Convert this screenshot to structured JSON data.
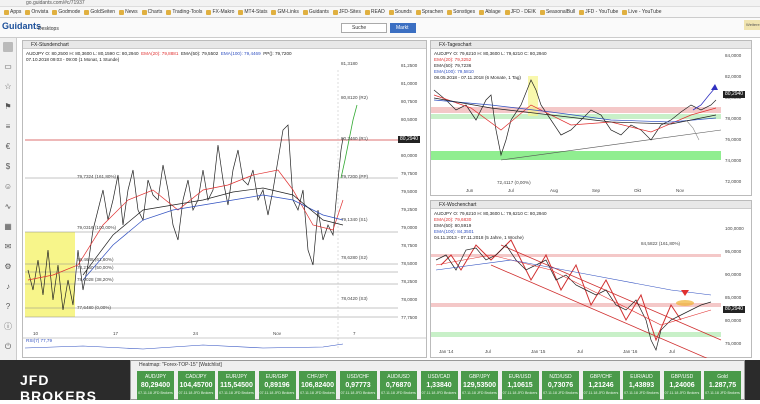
{
  "browser": {
    "url": "go.guidants.com/#c/71937",
    "bookmarks": [
      "Apps",
      "Onvista",
      "Godmode",
      "GoldSeiten",
      "News",
      "Charts",
      "Trading-Tools",
      "FX-Makro",
      "MT4-Stats",
      "GM-Links",
      "Guidants",
      "JFD-Sites",
      "READ",
      "Sounds",
      "Sprachen",
      "Sonstiges",
      "Ablage",
      "JFD - DEIK",
      "SeasonalBull",
      "JFD - YouTube",
      "Live - YouTube",
      "Weitere Lesez."
    ]
  },
  "app": {
    "logo": "Guidants",
    "search_label": "Suche",
    "markt_label": "Markt",
    "desktop_label": "Desktops"
  },
  "panel_left": {
    "title": "FX-Stundenchart",
    "info_line1": "AUDJPY  O: 80,2500  H: 80,3600  L: 80,1590  C: 80,2940",
    "ema20": "EMA(20): 79,8881",
    "ema50": "EMA(50): 79,5502",
    "ema100": "EMA(100): 79,4469",
    "pp": "PP(): 79,7200",
    "info_line2": "07.10.2018 09:03 - 09:00  (1 Monat, 1 Stunde)",
    "levels": [
      {
        "label": "81,3180",
        "name": ""
      },
      {
        "label": "80,8120 (R2)",
        "name": ""
      },
      {
        "label": "80,2460 (R1)",
        "name": ""
      },
      {
        "label": "79,7200 (PP)",
        "name": ""
      },
      {
        "label": "79,1340 (S1)",
        "name": ""
      },
      {
        "label": "78,6280 (S2)",
        "name": ""
      },
      {
        "label": "78,0420 (S3)",
        "name": ""
      }
    ],
    "fib_labels": [
      "79,7324 (161,80%)",
      "79,0316 (100,00%)",
      "78,4648 (61,80%)",
      "78,2160 (50,00%)",
      "78,0028 (38,20%)",
      "77,6480 (0,00%)"
    ],
    "y_axis": [
      "81,2500",
      "81,0000",
      "80,7500",
      "80,5000",
      "80,2500",
      "80,0000",
      "79,7500",
      "79,5000",
      "79,2500",
      "79,0000",
      "78,7500",
      "78,5000",
      "78,2500",
      "78,0000",
      "77,7500"
    ],
    "x_axis": [
      "10",
      "17",
      "24",
      "Nov",
      "7"
    ],
    "price": "80,2940",
    "rsi_label": "RSI(7) 77,79"
  },
  "panel_daily": {
    "title": "FX-Tageschart",
    "info_line1": "AUDJPY  O: 79,6210  H: 80,3600  L: 79,6210  C: 80,2940",
    "ema20": "EMA(20): 79,3252",
    "ema50": "EMA(50): 79,7236",
    "ema100": "EMA(100): 79,5810",
    "info_line2": "08.05.2018 - 07.11.2018  (6 Monate, 1 Tag)",
    "low_label": "72,4117 (0,00%)",
    "y_axis": [
      "84,0000",
      "82,0000",
      "80,0000",
      "78,0000",
      "76,0000",
      "74,0000",
      "72,0000"
    ],
    "x_axis": [
      "Jun",
      "Jul",
      "Aug",
      "Sep",
      "Okt",
      "Nov"
    ],
    "price": "80,2940"
  },
  "panel_weekly": {
    "title": "FX-Wochenchart",
    "info_line1": "AUDJPY  O: 79,6210  H: 80,3600  L: 79,6210  C: 80,2940",
    "ema20": "EMA(20): 79,6830",
    "ema50": "EMA(50): 80,5919",
    "ema100": "EMA(100): 84,3501",
    "info_line2": "04.11.2013 - 07.11.2018  (5 Jahre, 1 Woche)",
    "fib_label": "84,5822 (161,80%)",
    "y_axis": [
      "100,0000",
      "95,0000",
      "90,0000",
      "85,0000",
      "80,0000",
      "75,0000"
    ],
    "x_axis": [
      "Jan '14",
      "Jul",
      "Jan '15",
      "Jul",
      "Jan '16",
      "Jul"
    ],
    "price": "80,2940"
  },
  "heatmap": {
    "title": "Heatmap: \"Forex-TOP-15\" [Watchlist]",
    "broker": "JFD BROKERS",
    "tiles": [
      {
        "name": "AUD/JPY",
        "value": "80,29400",
        "sub": "07.11.18 JFD Brokers"
      },
      {
        "name": "CAD/JPY",
        "value": "104,45700",
        "sub": "07.11.18 JFD Brokers"
      },
      {
        "name": "EUR/JPY",
        "value": "115,54500",
        "sub": "07.11.18 JFD Brokers"
      },
      {
        "name": "EUR/GBP",
        "value": "0,89196",
        "sub": "07.11.18 JFD Brokers"
      },
      {
        "name": "CHF/JPY",
        "value": "106,82400",
        "sub": "07.11.18 JFD Brokers"
      },
      {
        "name": "USD/CHF",
        "value": "0,97773",
        "sub": "07.11.18 JFD Brokers"
      },
      {
        "name": "AUD/USD",
        "value": "0,76870",
        "sub": "07.11.18 JFD Brokers"
      },
      {
        "name": "USD/CAD",
        "value": "1,33840",
        "sub": "07.11.18 JFD Brokers"
      },
      {
        "name": "GBP/JPY",
        "value": "129,53500",
        "sub": "07.11.18 JFD Brokers"
      },
      {
        "name": "EUR/USD",
        "value": "1,10615",
        "sub": "07.11.18 JFD Brokers"
      },
      {
        "name": "NZD/USD",
        "value": "0,73076",
        "sub": "07.11.18 JFD Brokers"
      },
      {
        "name": "GBP/CHF",
        "value": "1,21246",
        "sub": "07.11.18 JFD Brokers"
      },
      {
        "name": "EUR/AUD",
        "value": "1,43893",
        "sub": "07.11.18 JFD Brokers"
      },
      {
        "name": "GBP/USD",
        "value": "1,24006",
        "sub": "07.11.18 JFD Brokers"
      },
      {
        "name": "Gold",
        "value": "1.287,75",
        "sub": "07.11.18 JFD Brokers"
      }
    ]
  },
  "colors": {
    "ema20": "#e03030",
    "ema50": "#222222",
    "ema100": "#3050c0",
    "candle_up": "#222222",
    "fib_zone": "#f7f58a",
    "support_zone": "#90ee90",
    "heat_green": "#4a9a4a"
  }
}
